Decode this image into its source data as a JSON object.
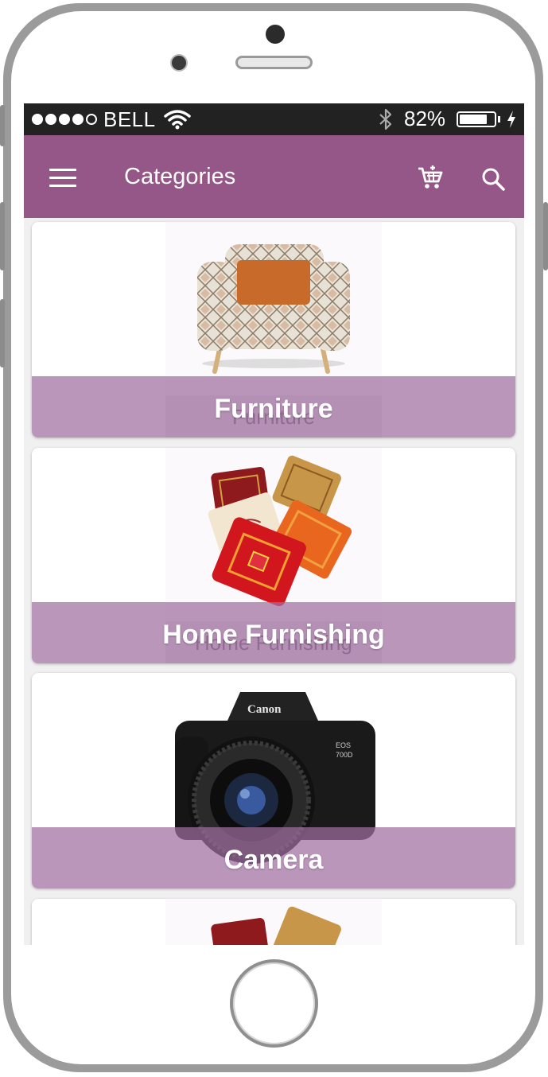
{
  "status_bar": {
    "signal_dots_filled": 4,
    "signal_dots_total": 5,
    "carrier": "BELL",
    "battery_percent": "82%",
    "battery_level": 0.82
  },
  "app_bar": {
    "title": "Categories",
    "color": "#955688",
    "icons": [
      "menu-icon",
      "cart-icon",
      "search-icon"
    ]
  },
  "categories": [
    {
      "label": "Furniture",
      "image": "armchair"
    },
    {
      "label": "Home Furnishing",
      "image": "cushions"
    },
    {
      "label": "Camera",
      "image": "camera",
      "brand_text": "Canon",
      "model_text": "EOS 700D"
    },
    {
      "label": "",
      "image": "cushions"
    }
  ],
  "colors": {
    "overlay": "#a06ea0",
    "status_bar": "#222222"
  }
}
